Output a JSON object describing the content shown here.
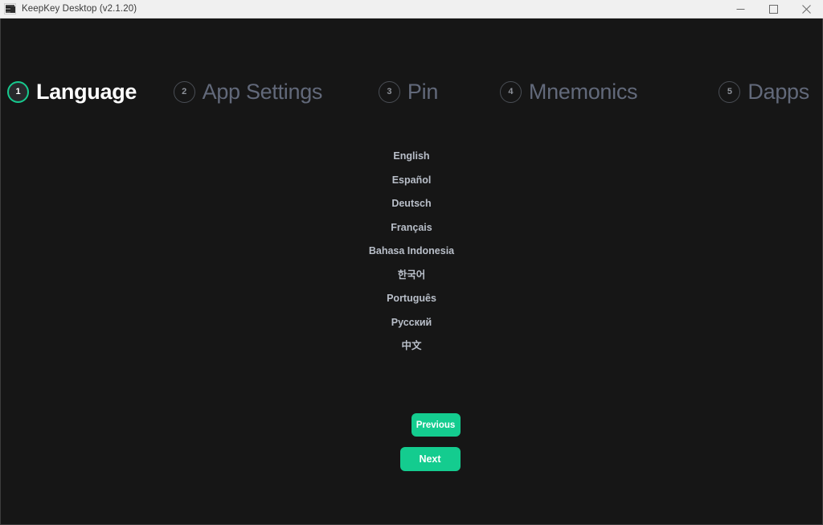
{
  "titlebar": {
    "icon": "keepkey-app-icon",
    "title": "KeepKey Desktop (v2.1.20)",
    "controls": {
      "minimize": "minimize-icon",
      "maximize": "maximize-icon",
      "close": "close-icon"
    }
  },
  "stepper": {
    "steps": [
      {
        "number": "1",
        "label": "Language",
        "state": "active"
      },
      {
        "number": "2",
        "label": "App Settings",
        "state": "inactive"
      },
      {
        "number": "3",
        "label": "Pin",
        "state": "inactive"
      },
      {
        "number": "4",
        "label": "Mnemonics",
        "state": "inactive"
      },
      {
        "number": "5",
        "label": "Dapps",
        "state": "inactive"
      }
    ]
  },
  "languages": [
    {
      "label": "English"
    },
    {
      "label": "Español"
    },
    {
      "label": "Deutsch"
    },
    {
      "label": "Français"
    },
    {
      "label": "Bahasa Indonesia"
    },
    {
      "label": "한국어"
    },
    {
      "label": "Português"
    },
    {
      "label": "Русский"
    },
    {
      "label": "中文"
    }
  ],
  "actions": {
    "previous_label": "Previous",
    "next_label": "Next"
  },
  "colors": {
    "accent": "#14cc8f",
    "active_ring": "#17c98e",
    "app_background": "#161616",
    "titlebar_background": "#f0f0f0",
    "inactive_step": "#62697a",
    "language_text": "#b9bfc9"
  }
}
